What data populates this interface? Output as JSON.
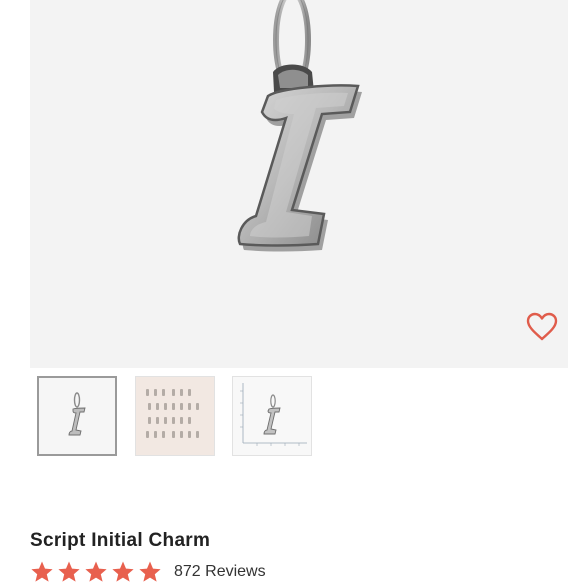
{
  "product": {
    "name": "Script Initial Charm",
    "review_count_label": "872 Reviews",
    "rating": 5,
    "rating_max": 5
  },
  "hero_image": {
    "subject": "silver script letter I charm on jump ring",
    "favorite_icon": "heart-outline-icon"
  },
  "thumbnails": [
    {
      "subject": "charm front view",
      "selected": true
    },
    {
      "subject": "all alphabet charms grid",
      "selected": false
    },
    {
      "subject": "charm with size scale",
      "selected": false
    }
  ],
  "colors": {
    "accent": "#e05c4b",
    "star": "#e8604e",
    "hero_background": "#f3f3f3",
    "title_text": "#222222"
  }
}
